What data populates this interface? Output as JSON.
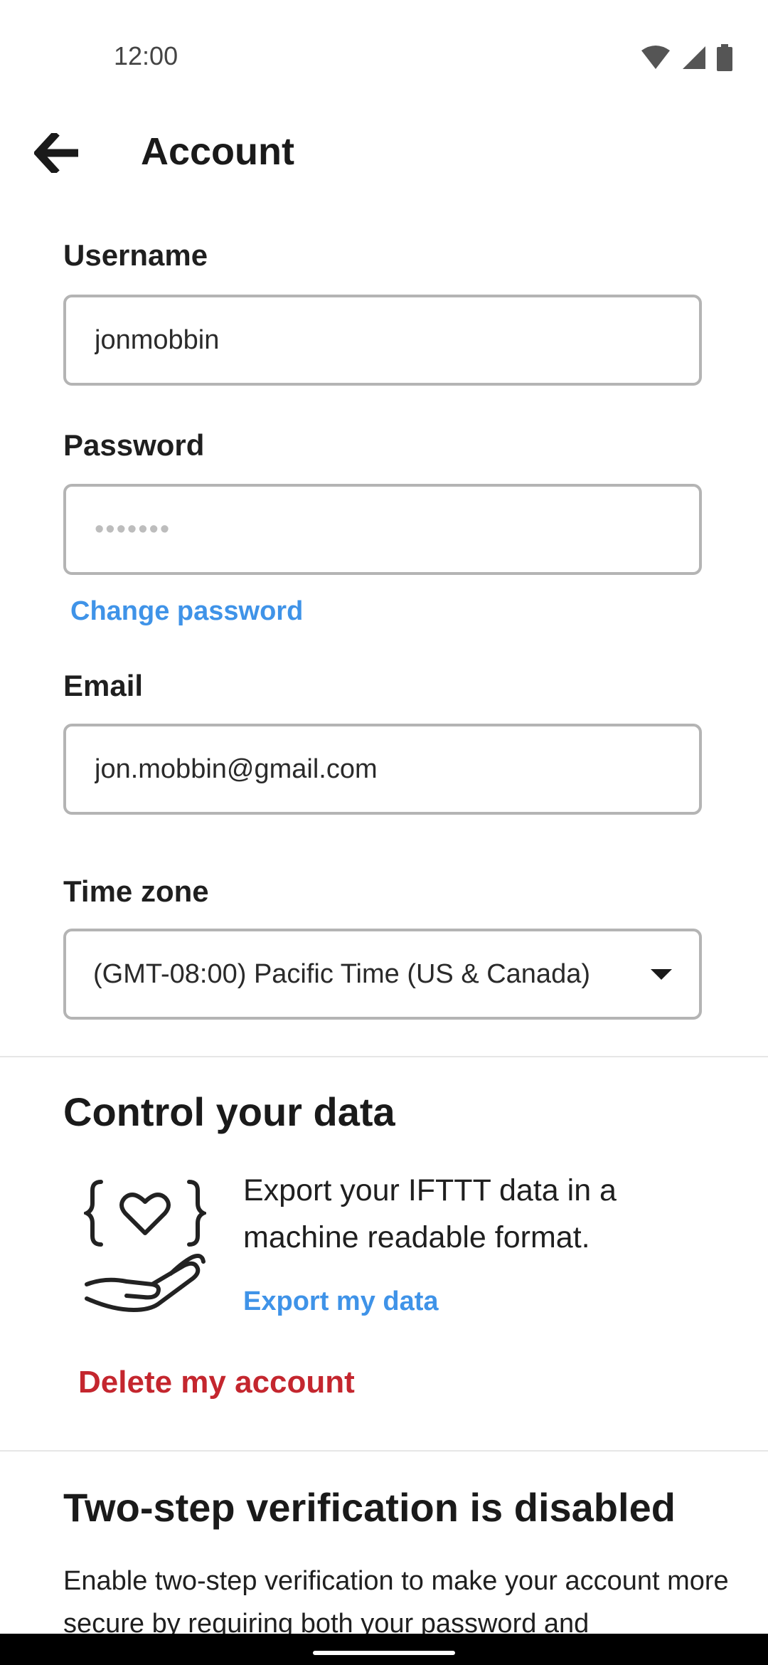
{
  "status_bar": {
    "time": "12:00"
  },
  "header": {
    "title": "Account"
  },
  "form": {
    "username": {
      "label": "Username",
      "value": "jonmobbin"
    },
    "password": {
      "label": "Password",
      "placeholder": "•••••••"
    },
    "change_password_label": "Change password",
    "email": {
      "label": "Email",
      "value": "jon.mobbin@gmail.com"
    },
    "timezone": {
      "label": "Time zone",
      "selected": "(GMT-08:00) Pacific Time (US & Canada)"
    }
  },
  "control_data": {
    "title": "Control your data",
    "description": "Export your IFTTT data in a machine readable format.",
    "export_link": "Export my data",
    "delete_link": "Delete my account"
  },
  "two_step": {
    "title": "Two-step verification is disabled",
    "description": "Enable two-step verification to make your account more secure by requiring both your password and"
  },
  "colors": {
    "link": "#3f93e8",
    "danger": "#c4262e"
  },
  "icons": [
    "wifi-icon",
    "cell-signal-icon",
    "battery-icon",
    "back-arrow-icon",
    "hand-heart-data-icon",
    "dropdown-caret-icon"
  ]
}
